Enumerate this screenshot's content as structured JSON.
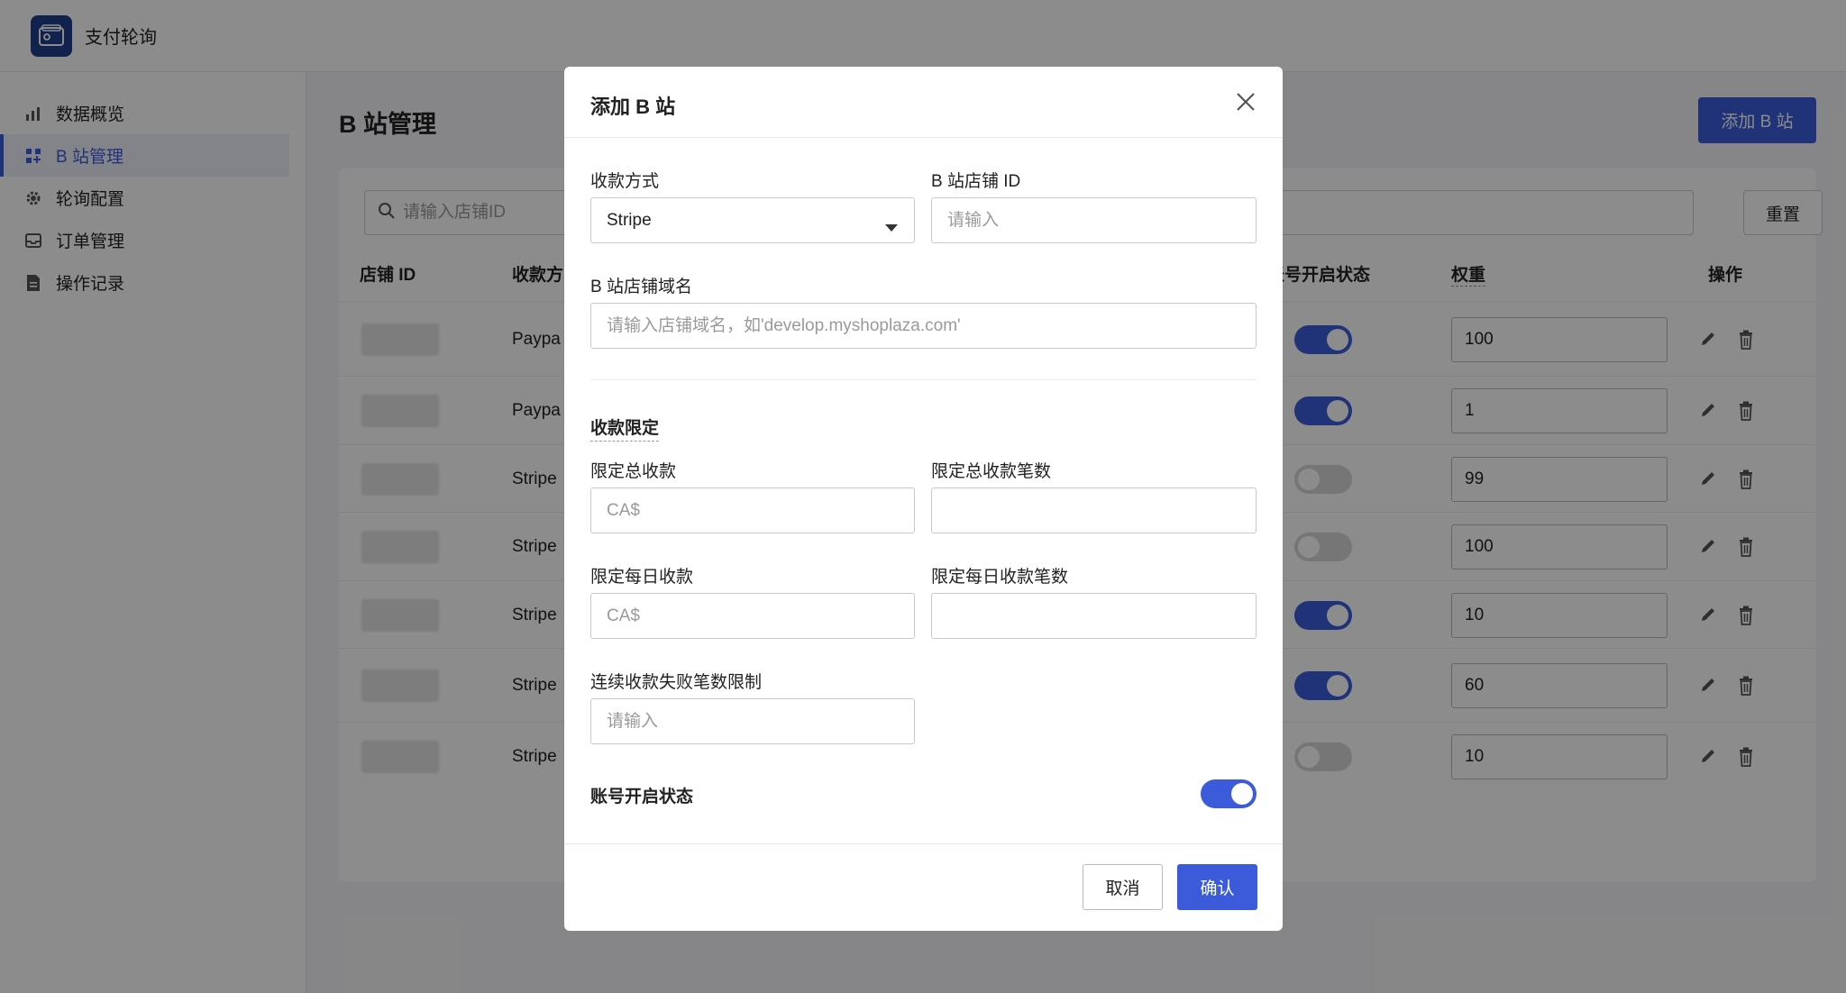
{
  "app": {
    "title": "支付轮询"
  },
  "sidebar": {
    "items": [
      {
        "label": "数据概览",
        "icon": "bar-chart-icon"
      },
      {
        "label": "B 站管理",
        "icon": "grid-icon",
        "active": true
      },
      {
        "label": "轮询配置",
        "icon": "gear-icon"
      },
      {
        "label": "订单管理",
        "icon": "inbox-icon"
      },
      {
        "label": "操作记录",
        "icon": "document-icon"
      }
    ]
  },
  "page": {
    "title": "B 站管理",
    "add_button": "添加 B 站",
    "search_placeholder": "请输入店铺ID",
    "reset_button": "重置",
    "columns": {
      "shop_id": "店铺 ID",
      "method": "收款方",
      "status": "账号开启状态",
      "weight": "权重",
      "actions": "操作"
    },
    "rows": [
      {
        "method": "Paypa",
        "enabled": true,
        "weight": "100"
      },
      {
        "method": "Paypa",
        "enabled": true,
        "weight": "1"
      },
      {
        "method": "Stripe",
        "enabled": false,
        "weight": "99"
      },
      {
        "method": "Stripe",
        "enabled": false,
        "weight": "100"
      },
      {
        "method": "Stripe",
        "enabled": true,
        "weight": "10"
      },
      {
        "method": "Stripe",
        "enabled": true,
        "weight": "60"
      },
      {
        "method": "Stripe",
        "enabled": false,
        "weight": "10"
      }
    ]
  },
  "modal": {
    "title": "添加 B 站",
    "payment_method": {
      "label": "收款方式",
      "value": "Stripe"
    },
    "shop_id": {
      "label": "B 站店铺 ID",
      "placeholder": "请输入"
    },
    "shop_domain": {
      "label": "B 站店铺域名",
      "placeholder": "请输入店铺域名，如'develop.myshoplaza.com'"
    },
    "limit_section": "收款限定",
    "total_amount": {
      "label": "限定总收款",
      "placeholder": "CA$"
    },
    "total_count": {
      "label": "限定总收款笔数",
      "placeholder": ""
    },
    "daily_amount": {
      "label": "限定每日收款",
      "placeholder": "CA$"
    },
    "daily_count": {
      "label": "限定每日收款笔数",
      "placeholder": ""
    },
    "fail_limit": {
      "label": "连续收款失败笔数限制",
      "placeholder": "请输入"
    },
    "status_label": "账号开启状态",
    "status_enabled": true,
    "cancel": "取消",
    "confirm": "确认"
  },
  "colors": {
    "accent": "#3b5bdb",
    "overlay": "rgba(0,0,0,0.45)"
  }
}
